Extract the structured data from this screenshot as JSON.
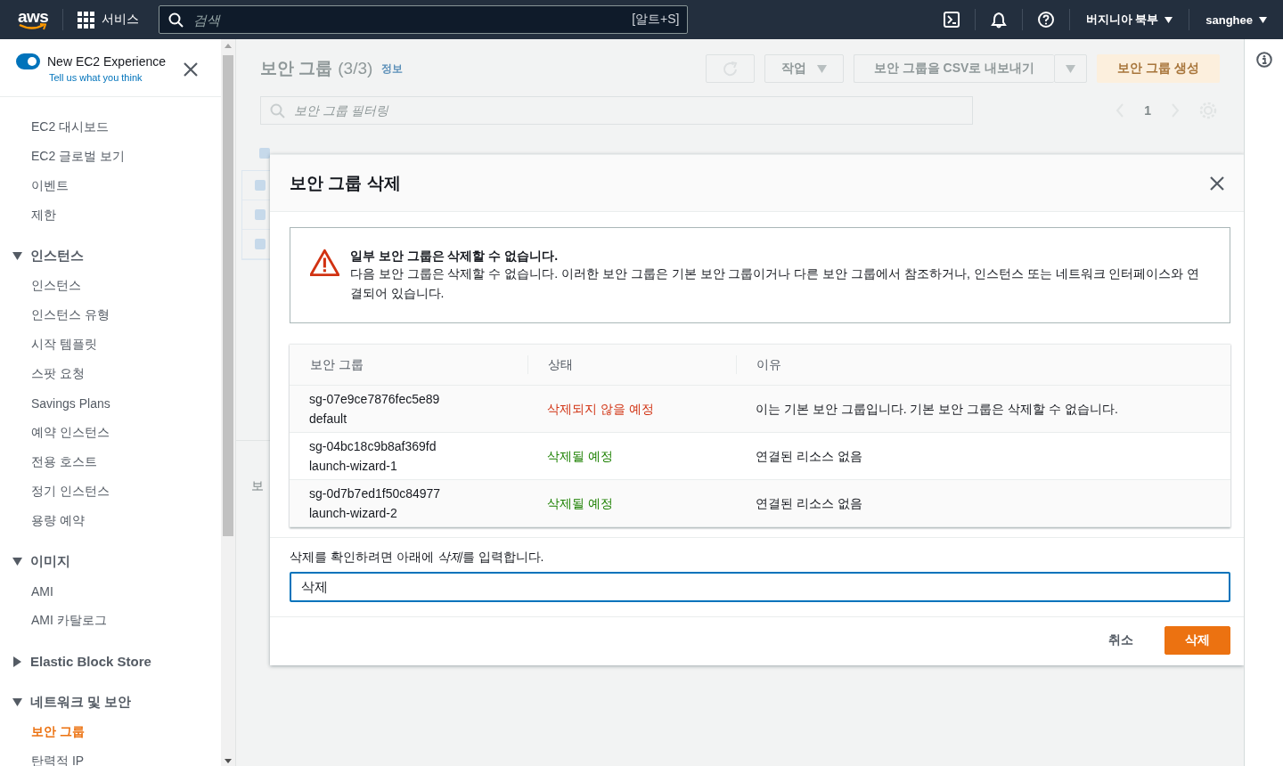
{
  "topbar": {
    "logo": "aws",
    "services": "서비스",
    "search": {
      "placeholder": "검색",
      "shortcut": "[알트+S]"
    },
    "region": "버지니아 북부",
    "user": "sanghee"
  },
  "sidebar": {
    "experience": {
      "label": "New EC2 Experience",
      "on": true,
      "link": "Tell us what you think"
    },
    "groups": [
      {
        "items": [
          {
            "label": "EC2 대시보드",
            "selected": false
          },
          {
            "label": "EC2 글로벌 보기",
            "selected": false
          },
          {
            "label": "이벤트",
            "selected": false
          },
          {
            "label": "제한",
            "selected": false
          }
        ]
      },
      {
        "title": "인스턴스",
        "expanded": true,
        "items": [
          {
            "label": "인스턴스",
            "selected": false
          },
          {
            "label": "인스턴스 유형",
            "selected": false
          },
          {
            "label": "시작 템플릿",
            "selected": false
          },
          {
            "label": "스팟 요청",
            "selected": false
          },
          {
            "label": "Savings Plans",
            "selected": false
          },
          {
            "label": "예약 인스턴스",
            "selected": false
          },
          {
            "label": "전용 호스트",
            "selected": false
          },
          {
            "label": "정기 인스턴스",
            "selected": false
          },
          {
            "label": "용량 예약",
            "selected": false
          }
        ]
      },
      {
        "title": "이미지",
        "expanded": true,
        "items": [
          {
            "label": "AMI",
            "selected": false
          },
          {
            "label": "AMI 카탈로그",
            "selected": false
          }
        ]
      },
      {
        "title": "Elastic Block Store",
        "expanded": false
      },
      {
        "title": "네트워크 및 보안",
        "expanded": true,
        "items": [
          {
            "label": "보안 그룹",
            "selected": true
          },
          {
            "label": "탄력적 IP",
            "selected": false
          }
        ]
      }
    ]
  },
  "page": {
    "title": "보안 그룹",
    "count": "(3/3)",
    "info": "정보",
    "actions": "작업",
    "export": "보안 그룹을 CSV로 내보내기",
    "create": "보안 그룹 생성",
    "filter_placeholder": "보안 그룹 필터링",
    "page_number": "1",
    "section_label": "보",
    "rows": [
      {
        "checked": true
      },
      {
        "checked": true
      },
      {
        "checked": true
      },
      {
        "checked": true
      }
    ]
  },
  "modal": {
    "title": "보안 그룹 삭제",
    "alert": {
      "title": "일부 보안 그룹은 삭제할 수 없습니다.",
      "text": "다음 보안 그룹은 삭제할 수 없습니다. 이러한 보안 그룹은 기본 보안 그룹이거나 다른 보안 그룹에서 참조하거나, 인스턴스 또는 네트워크 인터페이스와 연결되어 있습니다."
    },
    "table": {
      "columns": [
        "보안 그룹",
        "상태",
        "이유"
      ],
      "rows": [
        {
          "id": "sg-07e9ce7876fec5e89",
          "name": "default",
          "status": "삭제되지 않을 예정",
          "deletable": false,
          "reason": "이는 기본 보안 그룹입니다. 기본 보안 그룹은 삭제할 수 없습니다."
        },
        {
          "id": "sg-04bc18c9b8af369fd",
          "name": "launch-wizard-1",
          "status": "삭제될 예정",
          "deletable": true,
          "reason": "연결된 리소스 없음"
        },
        {
          "id": "sg-0d7b7ed1f50c84977",
          "name": "launch-wizard-2",
          "status": "삭제될 예정",
          "deletable": true,
          "reason": "연결된 리소스 없음"
        }
      ]
    },
    "confirm_text": {
      "before": "삭제를 확인하려면 아래에 ",
      "emphasis": "삭제",
      "after": "를 입력합니다."
    },
    "input_value": "삭제",
    "cancel": "취소",
    "delete": "삭제"
  }
}
